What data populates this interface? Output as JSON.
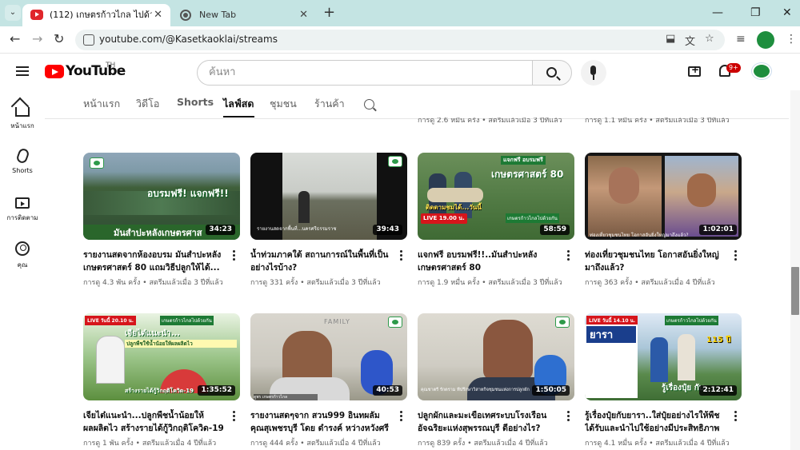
{
  "browser": {
    "tabs": [
      {
        "title": "(112) เกษตรก้าวไกล ไปด้วยกัน - Yo",
        "close": "✕"
      },
      {
        "title": "New Tab",
        "close": "✕"
      }
    ],
    "tab_list_glyph": "⌄",
    "new_tab_glyph": "+",
    "window_controls": [
      "—",
      "❐",
      "✕"
    ],
    "nav": {
      "back": "←",
      "forward": "→",
      "reload": "↻"
    },
    "url": "youtube.com/@Kasetkaoklai/streams",
    "omnibox_icons": [
      "install-icon",
      "translate-icon",
      "star-icon"
    ],
    "toolbar_icons": [
      "media-icon",
      "menu-icon"
    ]
  },
  "youtube": {
    "logo_text": "YouTube",
    "country_code": "TH",
    "search_placeholder": "ค้นหา",
    "notification_count": "9+",
    "rail": [
      {
        "label": "หน้าแรก",
        "icon": "home-icon"
      },
      {
        "label": "Shorts",
        "icon": "shorts-icon"
      },
      {
        "label": "การติดตาม",
        "icon": "subscriptions-icon"
      },
      {
        "label": "คุณ",
        "icon": "you-icon"
      }
    ],
    "channel_tabs": [
      "หน้าแรก",
      "วิดีโอ",
      "Shorts",
      "ไลฟ์สด",
      "ชุมชน",
      "ร้านค้า"
    ],
    "selected_tab": "ไลฟ์สด"
  },
  "prev_row_meta": [
    "การดู 2.6 หมื่น ครั้ง • สตรีมแล้วเมื่อ 3 ปีที่แล้ว",
    "การดู 1.1 หมื่น ครั้ง • สตรีมแล้วเมื่อ 3 ปีที่แล้ว"
  ],
  "videos": [
    {
      "title": "รายงานสดจากห้องอบรม มันสำปะหลัง เกษตรศาสตร์ 80 แถมวิธีปลูกให้ได้...",
      "meta": "การดู 4.3 พัน ครั้ง • สตรีมแล้วเมื่อ 3 ปีที่แล้ว",
      "duration": "34:23",
      "overlay": [
        "อบรมฟรี! แจกฟรี!!",
        "มันสำปะหลังเกษตรศาส"
      ]
    },
    {
      "title": "น้ำท่วมภาคใต้ สถานการณ์ในพื้นที่เป็นอย่างไรบ้าง?",
      "meta": "การดู 331 ครั้ง • สตรีมแล้วเมื่อ 3 ปีที่แล้ว",
      "duration": "39:43",
      "overlay": [
        "รายงานสดจากพื้นที่...นครศรีธรรมราช"
      ]
    },
    {
      "title": "แจกฟรี อบรมฟรี!!..มันสำปะหลัง เกษตรศาสตร์ 80",
      "meta": "การดู 1.9 หมื่น ครั้ง • สตรีมแล้วเมื่อ 3 ปีที่แล้ว",
      "duration": "58:59",
      "overlay": [
        "แจกฟรี อบรมฟรี",
        "เกษตรศาสตร์ 80",
        "ติดตามชมได้...วันนี้",
        "LIVE 19.00 น.",
        "เกษตรก้าวไกลไปด้วยกัน"
      ]
    },
    {
      "title": "ท่องเที่ยวชุมชนไทย โอกาสอันยิ่งใหญ่มาถึงแล้ว?",
      "meta": "การดู 363 ครั้ง • สตรีมแล้วเมื่อ 4 ปีที่แล้ว",
      "duration": "1:02:01",
      "overlay": [
        "ท่องเที่ยวชุมชนไทย โอกาสอันยิ่งใหญ่มาถึงแล้ว?"
      ]
    },
    {
      "title": "เจียไต๋แนะนำ...ปลูกพืชน้ำน้อยให้ผลผลิตไว สร้างรายได้กู้วิกฤติโควิด-19",
      "meta": "การดู 1 พัน ครั้ง • สตรีมแล้วเมื่อ 4 ปีที่แล้ว",
      "duration": "1:35:52",
      "overlay": [
        "LIVE วันนี้ 20.10 น.",
        "เกษตรก้าวไกลไปด้วยกัน",
        "เจียไต๋แนะนำ...",
        "ปลูกพืชใช้น้ำน้อยให้ผลผลิตไว",
        "สร้างรายได้กู้วิกฤติโควิด-19"
      ]
    },
    {
      "title": "รายงานสดๆจาก สวน999 อินทผลัมคุณสุเพชรบุรี โดย ดำรงค์ หว่างหวังศรี",
      "meta": "การดู 444 ครั้ง • สตรีมแล้วเมื่อ 4 ปีที่แล้ว",
      "duration": "40:53",
      "overlay": [
        "FAMILY",
        "ดูพร เกษตรก้าวไกล"
      ]
    },
    {
      "title": "ปลูกผักและมะเขือเทศระบบโรงเรือน อัจฉริยะแห่งสุพรรณบุรี ดีอย่างไร?",
      "meta": "การดู 839 ครั้ง • สตรีมแล้วเมื่อ 4 ปีที่แล้ว",
      "duration": "1:50:05",
      "overlay": [
        "คุณชาตรี รักตราม ที่ปรึกษาวิสาหกิจชุมชนแห่งการปลูกผัก"
      ]
    },
    {
      "title": "รู้เรื่องปุ๋ยกับยารา..ใส่ปุ๋ยอย่างไรให้พืชได้รับและนำไปใช้อย่างมีประสิทธิภาพมา...",
      "meta": "การดู 4.1 หมื่น ครั้ง • สตรีมแล้วเมื่อ 4 ปีที่แล้ว",
      "duration": "2:12:41",
      "overlay": [
        "LIVE วันนี้ 14.10 น.",
        "เกษตรก้าวไกลไปด้วยกัน",
        "ยารา",
        "รู้เรื่องปุ๋ย กับ",
        "115 ปี"
      ]
    }
  ]
}
